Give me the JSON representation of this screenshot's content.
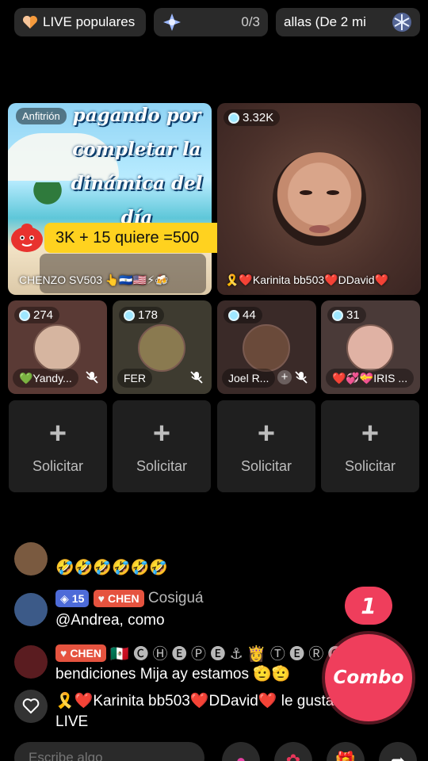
{
  "top_bar": {
    "live_label": "LIVE populares",
    "progress": "0/3",
    "news": "allas (De 2 mi"
  },
  "grid": {
    "host": {
      "badge": "Anfitrión",
      "promo_text": "pagando por completar la dinámica del día",
      "banner": "3K + 15 quiere =500",
      "name": "CHENZO SV503 👆🇸🇻🇺🇸⚡🍻"
    },
    "guest_main": {
      "count": "3.32K",
      "name": "🎗️❤️Karinita bb503❤️DDavid❤️"
    },
    "guests": [
      {
        "count": "274",
        "name": "💚Yandy..."
      },
      {
        "count": "178",
        "name": "FER"
      },
      {
        "count": "44",
        "name": "Joel R..."
      },
      {
        "count": "31",
        "name": "❤️💞💝IRIS ..."
      }
    ],
    "slots": [
      {
        "label": "Solicitar"
      },
      {
        "label": "Solicitar"
      },
      {
        "label": "Solicitar"
      },
      {
        "label": "Solicitar"
      }
    ]
  },
  "chat": {
    "messages": [
      {
        "text": "🤣🤣🤣🤣🤣🤣"
      },
      {
        "level": "15",
        "badge": "CHEN",
        "user": "Cosiguá",
        "text": "@Andrea, como"
      },
      {
        "badge": "CHEN",
        "user": "🇲🇽 🅒 Ⓗ 🅔 Ⓟ 🅔 ⚓ 👸 Ⓣ 🅔 Ⓡ 🅞",
        "text": "bendiciones Mija ay estamos 🫡🫡"
      },
      {
        "text": "🎗️❤️Karinita bb503❤️DDavid❤️ le gusta al LIVE"
      }
    ]
  },
  "combo": {
    "count": "1",
    "label": "Combo"
  },
  "input": {
    "placeholder": "Escribe algo"
  },
  "colors": {
    "accent": "#ef3e5c",
    "banner": "#ffd21f",
    "level_badge": "#4d6bd8",
    "fan_badge": "#e5533f"
  }
}
